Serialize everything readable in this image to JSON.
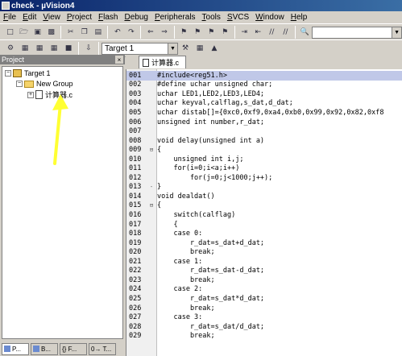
{
  "window": {
    "title": "check - µVision4"
  },
  "menu": [
    "File",
    "Edit",
    "View",
    "Project",
    "Flash",
    "Debug",
    "Peripherals",
    "Tools",
    "SVCS",
    "Window",
    "Help"
  ],
  "toolbar2": {
    "target": "Target 1"
  },
  "project_panel": {
    "title": "Project",
    "tree": {
      "target": "Target 1",
      "group": "New Group",
      "file": "计算器.c"
    },
    "tabs": [
      "P...",
      "B...",
      "{} F...",
      "0→ T..."
    ]
  },
  "editor": {
    "tab_label": "计算器.c",
    "lines": [
      {
        "n": "001",
        "fold": "",
        "text": "#include<reg51.h>"
      },
      {
        "n": "002",
        "fold": "",
        "text": "#define uchar unsigned char;"
      },
      {
        "n": "003",
        "fold": "",
        "text": "uchar LED1,LED2,LED3,LED4;"
      },
      {
        "n": "004",
        "fold": "",
        "text": "uchar keyval,calflag,s_dat,d_dat;"
      },
      {
        "n": "005",
        "fold": "",
        "text": "uchar distab[]={0xc0,0xf9,0xa4,0xb0,0x99,0x92,0x82,0xf8"
      },
      {
        "n": "006",
        "fold": "",
        "text": "unsigned int number,r_dat;"
      },
      {
        "n": "007",
        "fold": "",
        "text": ""
      },
      {
        "n": "008",
        "fold": "",
        "text": "void delay(unsigned int a)"
      },
      {
        "n": "009",
        "fold": "⊟",
        "text": "{"
      },
      {
        "n": "010",
        "fold": "",
        "text": "    unsigned int i,j;"
      },
      {
        "n": "011",
        "fold": "",
        "text": "    for(i=0;i<a;i++)"
      },
      {
        "n": "012",
        "fold": "",
        "text": "        for(j=0;j<1000;j++);"
      },
      {
        "n": "013",
        "fold": "-",
        "text": "}"
      },
      {
        "n": "014",
        "fold": "",
        "text": "void dealdat()"
      },
      {
        "n": "015",
        "fold": "⊟",
        "text": "{"
      },
      {
        "n": "016",
        "fold": "",
        "text": "    switch(calflag)"
      },
      {
        "n": "017",
        "fold": "",
        "text": "    {"
      },
      {
        "n": "018",
        "fold": "",
        "text": "    case 0:"
      },
      {
        "n": "019",
        "fold": "",
        "text": "        r_dat=s_dat+d_dat;"
      },
      {
        "n": "020",
        "fold": "",
        "text": "        break;"
      },
      {
        "n": "021",
        "fold": "",
        "text": "    case 1:"
      },
      {
        "n": "022",
        "fold": "",
        "text": "        r_dat=s_dat-d_dat;"
      },
      {
        "n": "023",
        "fold": "",
        "text": "        break;"
      },
      {
        "n": "024",
        "fold": "",
        "text": "    case 2:"
      },
      {
        "n": "025",
        "fold": "",
        "text": "        r_dat=s_dat*d_dat;"
      },
      {
        "n": "026",
        "fold": "",
        "text": "        break;"
      },
      {
        "n": "027",
        "fold": "",
        "text": "    case 3:"
      },
      {
        "n": "028",
        "fold": "",
        "text": "        r_dat=s_dat/d_dat;"
      },
      {
        "n": "029",
        "fold": "",
        "text": "        break;"
      }
    ]
  },
  "colors": {
    "title_start": "#0a246a",
    "title_end": "#3a6ea5",
    "highlight_line": "#c0c8e8",
    "annotation": "#ffff33"
  }
}
